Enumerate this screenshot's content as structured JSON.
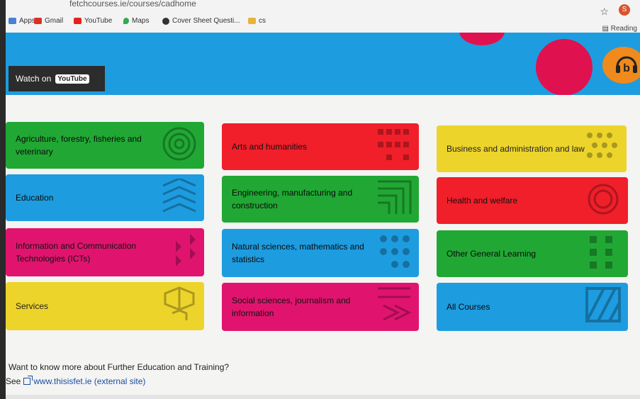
{
  "browser": {
    "url": "fetchcourses.ie/courses/cadhome",
    "bookmarks": [
      "Apps",
      "Gmail",
      "YouTube",
      "Maps",
      "Cover Sheet Questi...",
      "cs"
    ],
    "profile_initial": "S",
    "reading_label": "Reading"
  },
  "banner": {
    "watch_label": "Watch on",
    "youtube_label": "YouTube",
    "audio_icon": "b"
  },
  "categories": [
    {
      "label": "Agriculture, forestry, fisheries and veterinary",
      "color": "#21a834"
    },
    {
      "label": "Arts and humanities",
      "color": "#f01f2a"
    },
    {
      "label": "Business and administration and law",
      "color": "#ecd42b"
    },
    {
      "label": "Education",
      "color": "#1e9ce0"
    },
    {
      "label": "Engineering, manufacturing and construction",
      "color": "#21a834"
    },
    {
      "label": "Health and welfare",
      "color": "#f01f2a"
    },
    {
      "label": "Information and Communication Technologies (ICTs)",
      "color": "#e0146e"
    },
    {
      "label": "Natural sciences, mathematics and statistics",
      "color": "#1e9ce0"
    },
    {
      "label": "Other General Learning",
      "color": "#21a834"
    },
    {
      "label": "Services",
      "color": "#ecd42b"
    },
    {
      "label": "Social sciences, journalism and information",
      "color": "#e0146e"
    },
    {
      "label": "All Courses",
      "color": "#1e9ce0"
    }
  ],
  "footer": {
    "question": "Want to know more about Further Education and Training?",
    "see_label": "See",
    "link_text": "www.thisisfet.ie (external site)"
  }
}
